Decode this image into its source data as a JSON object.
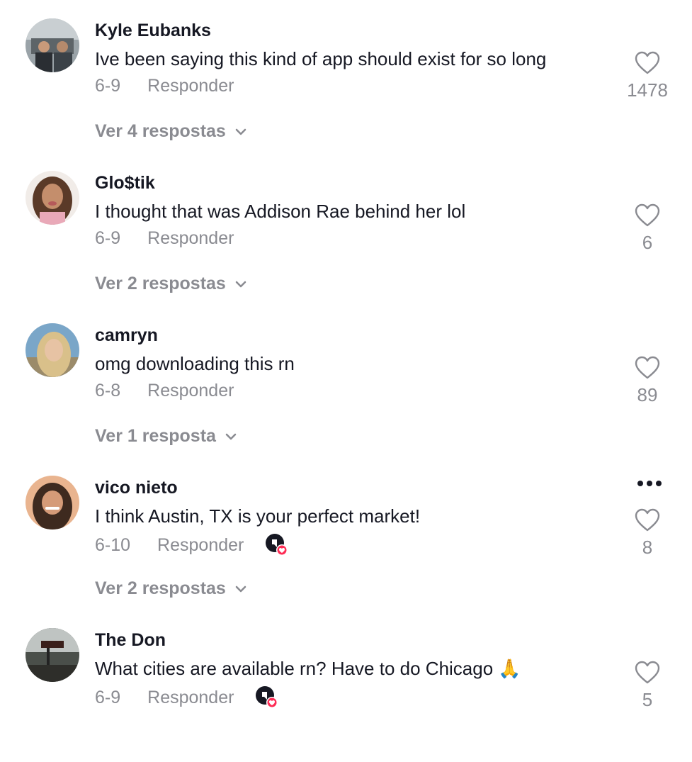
{
  "colors": {
    "text_primary": "#161823",
    "text_secondary": "#8a8b91",
    "creator_badge": "#fe2c55"
  },
  "comments": [
    {
      "username": "Kyle Eubanks",
      "text": "Ive been saying this kind of app should exist for so long",
      "date": "6-9",
      "reply_label": "Responder",
      "like_count": "1478",
      "view_replies": "Ver 4 respostas",
      "creator_liked": false
    },
    {
      "username": "Glo$tik",
      "text": "I thought that was Addison Rae behind her lol",
      "date": "6-9",
      "reply_label": "Responder",
      "like_count": "6",
      "view_replies": "Ver 2 respostas",
      "creator_liked": false
    },
    {
      "username": "camryn",
      "text": "omg downloading this rn",
      "date": "6-8",
      "reply_label": "Responder",
      "like_count": "89",
      "view_replies": "Ver 1 resposta",
      "creator_liked": false
    },
    {
      "username": "vico nieto",
      "text": "I think Austin, TX is your perfect market!",
      "date": "6-10",
      "reply_label": "Responder",
      "like_count": "8",
      "view_replies": "Ver 2 respostas",
      "creator_liked": true,
      "has_more_menu": true
    },
    {
      "username": "The Don",
      "text": "What cities are available rn? Have to do Chicago 🙏",
      "date": "6-9",
      "reply_label": "Responder",
      "like_count": "5",
      "creator_liked": true
    }
  ]
}
